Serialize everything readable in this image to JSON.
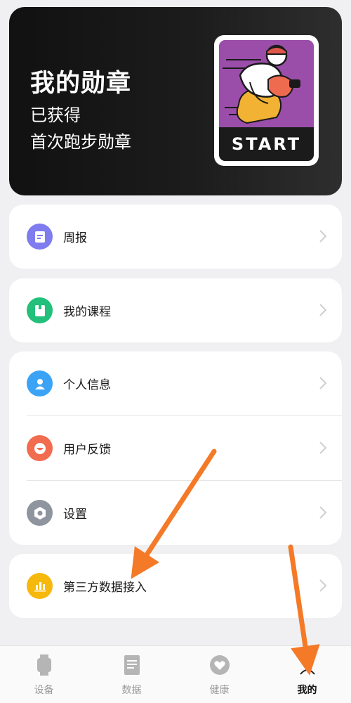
{
  "banner": {
    "title": "我的勋章",
    "line1": "已获得",
    "line2": "首次跑步勋章",
    "medal_label": "START"
  },
  "menu": {
    "weekly": "周报",
    "courses": "我的课程",
    "profile": "个人信息",
    "feedback": "用户反馈",
    "settings": "设置",
    "third_party": "第三方数据接入"
  },
  "tabbar": {
    "items": [
      {
        "label": "设备",
        "icon": "watch-icon"
      },
      {
        "label": "数据",
        "icon": "document-icon"
      },
      {
        "label": "健康",
        "icon": "heart-icon"
      },
      {
        "label": "我的",
        "icon": "profile-icon"
      }
    ],
    "active": "我的"
  },
  "colors": {
    "weekly_icon": "#7f7cf0",
    "courses_icon": "#22c07a",
    "profile_icon": "#3ba3f5",
    "feedback_icon": "#f26c4f",
    "settings_icon": "#8e959e",
    "third_party_icon": "#f7b80d",
    "annotation_arrow": "#f47a28"
  }
}
